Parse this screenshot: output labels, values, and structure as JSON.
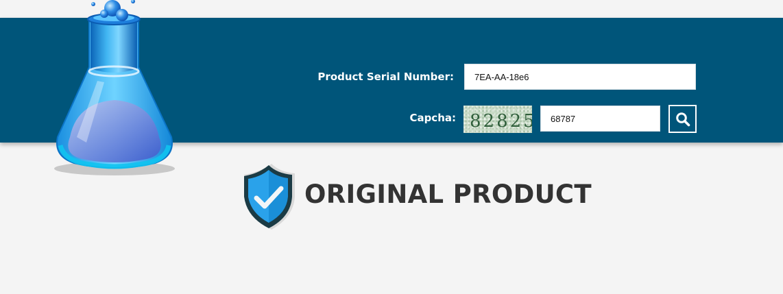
{
  "form": {
    "serial_label": "Product Serial Number:",
    "serial_value": "7EA-AA-18e6",
    "captcha_label": "Capcha:",
    "captcha_image_text": "82825",
    "captcha_value": "68787",
    "search_icon": "search-icon"
  },
  "result": {
    "status_text": "ORIGINAL PRODUCT",
    "icon": "shield-check-icon"
  },
  "branding": {
    "logo_icon": "flask-icon"
  },
  "colors": {
    "banner": "#00557a",
    "background": "#f4f4f4",
    "shield_blue": "#1a8fd8",
    "result_text": "#333333"
  }
}
